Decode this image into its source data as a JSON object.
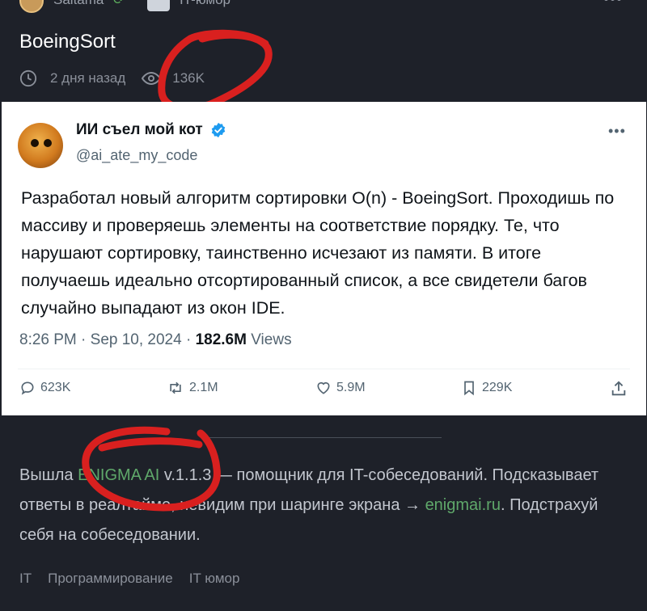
{
  "topbar": {
    "author": "Saitama",
    "channel": "IT-юмор",
    "more_icon": "more-dots-icon"
  },
  "post": {
    "title": "BoeingSort",
    "time_ago": "2 дня назад",
    "views": "136K"
  },
  "tweet": {
    "name": "ИИ съел мой кот",
    "handle": "@ai_ate_my_code",
    "text": "Разработал новый алгоритм сортировки O(n) - BoeingSort. Проходишь по массиву и проверяешь элементы на соответствие порядку. Те, что нарушают сортировку, таинственно исчезают из памяти. В итоге получаешь идеально отсортированный список, а все свидетели багов случайно выпадают из окон IDE.",
    "date": "8:26 PM · Sep 10, 2024 · ",
    "views_count": "182.6M",
    "views_label": " Views",
    "replies": "623K",
    "reposts": "2.1M",
    "likes": "5.9M",
    "bookmarks": "229K"
  },
  "promo": {
    "part1": "Вышла ",
    "brand": "ENIGMA AI",
    "part2": " v.1.1.3 — помощник для IT-собеседований. Подсказывает ответы в реалтайме, невидим при шаринге экрана → ",
    "link": "enigmai.ru",
    "part3": ". Подстрахуй себя на собеседовании."
  },
  "tags": [
    "IT",
    "Программирование",
    "IT юмор"
  ],
  "colors": {
    "background": "#1e2129",
    "link_green": "#5fa86a",
    "scribble_red": "#d9201f",
    "twitter_blue": "#1d9bf0"
  }
}
